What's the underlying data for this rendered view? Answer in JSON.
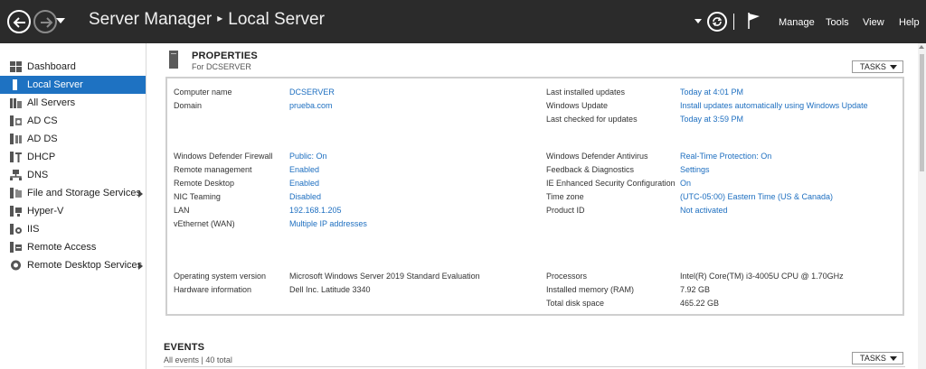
{
  "titlebar": {
    "app": "Server Manager",
    "separator": "▸",
    "section": "Local Server",
    "menu": [
      "Manage",
      "Tools",
      "View",
      "Help"
    ]
  },
  "sidebar": {
    "items": [
      {
        "label": "Dashboard",
        "icon": "dashboard-icon",
        "active": false,
        "expandable": false
      },
      {
        "label": "Local Server",
        "icon": "server-icon",
        "active": true,
        "expandable": false
      },
      {
        "label": "All Servers",
        "icon": "servers-icon",
        "active": false,
        "expandable": false
      },
      {
        "label": "AD CS",
        "icon": "ad-cs-icon",
        "active": false,
        "expandable": false
      },
      {
        "label": "AD DS",
        "icon": "ad-ds-icon",
        "active": false,
        "expandable": false
      },
      {
        "label": "DHCP",
        "icon": "dhcp-icon",
        "active": false,
        "expandable": false
      },
      {
        "label": "DNS",
        "icon": "dns-icon",
        "active": false,
        "expandable": false
      },
      {
        "label": "File and Storage Services",
        "icon": "file-storage-icon",
        "active": false,
        "expandable": true
      },
      {
        "label": "Hyper-V",
        "icon": "hyper-v-icon",
        "active": false,
        "expandable": false
      },
      {
        "label": "IIS",
        "icon": "iis-icon",
        "active": false,
        "expandable": false
      },
      {
        "label": "Remote Access",
        "icon": "remote-access-icon",
        "active": false,
        "expandable": false
      },
      {
        "label": "Remote Desktop Services",
        "icon": "remote-desktop-icon",
        "active": false,
        "expandable": true
      }
    ]
  },
  "properties": {
    "title": "PROPERTIES",
    "subtitle": "For DCSERVER",
    "tasks_label": "TASKS",
    "left_group1": [
      {
        "label": "Computer name",
        "value": "DCSERVER"
      },
      {
        "label": "Domain",
        "value": "prueba.com"
      }
    ],
    "right_group1": [
      {
        "label": "Last installed updates",
        "value": "Today at 4:01 PM"
      },
      {
        "label": "Windows Update",
        "value": "Install updates automatically using Windows Update"
      },
      {
        "label": "Last checked for updates",
        "value": "Today at 3:59 PM"
      }
    ],
    "left_group2": [
      {
        "label": "Windows Defender Firewall",
        "value": "Public: On"
      },
      {
        "label": "Remote management",
        "value": "Enabled"
      },
      {
        "label": "Remote Desktop",
        "value": "Enabled"
      },
      {
        "label": "NIC Teaming",
        "value": "Disabled"
      },
      {
        "label": "LAN",
        "value": "192.168.1.205"
      },
      {
        "label": "vEthernet (WAN)",
        "value": "Multiple IP addresses"
      }
    ],
    "right_group2": [
      {
        "label": "Windows Defender Antivirus",
        "value": "Real-Time Protection: On"
      },
      {
        "label": "Feedback & Diagnostics",
        "value": "Settings"
      },
      {
        "label": "IE Enhanced Security Configuration",
        "value": "On"
      },
      {
        "label": "Time zone",
        "value": "(UTC-05:00) Eastern Time (US & Canada)"
      },
      {
        "label": "Product ID",
        "value": "Not activated"
      }
    ],
    "left_group3": [
      {
        "label": "Operating system version",
        "value": "Microsoft Windows Server 2019 Standard Evaluation"
      },
      {
        "label": "Hardware information",
        "value": "Dell Inc. Latitude 3340"
      }
    ],
    "right_group3": [
      {
        "label": "Processors",
        "value": "Intel(R) Core(TM) i3-4005U CPU @ 1.70GHz"
      },
      {
        "label": "Installed memory (RAM)",
        "value": "7.92 GB"
      },
      {
        "label": "Total disk space",
        "value": "465.22 GB"
      }
    ]
  },
  "events": {
    "title": "EVENTS",
    "subtitle": "All events | 40 total",
    "tasks_label": "TASKS"
  },
  "colors": {
    "titlebar": "#2b2b2b",
    "active_item": "#1e72c2",
    "link": "#1e6fc0"
  }
}
